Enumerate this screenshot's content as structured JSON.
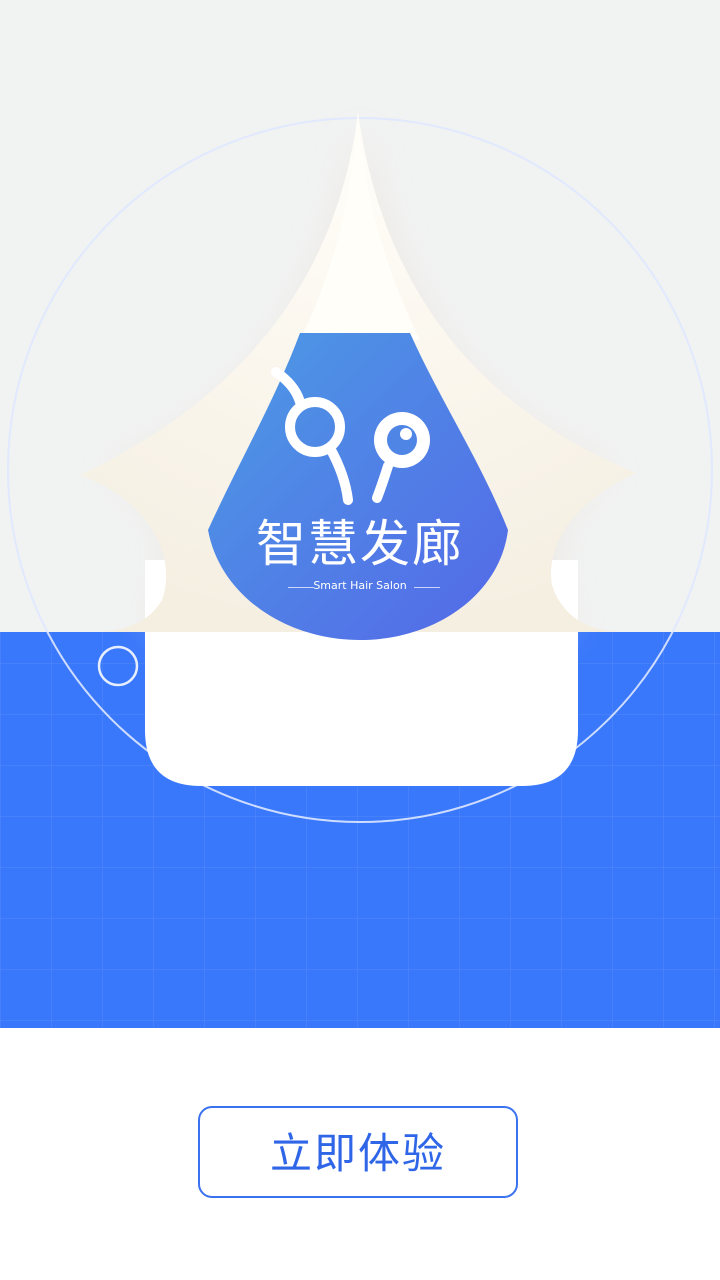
{
  "brand": {
    "title": "智慧发廊",
    "subtitle": "Smart Hair Salon",
    "logo_icon": "scissors-mirror-logo-icon"
  },
  "cta": {
    "label": "立即体验"
  },
  "colors": {
    "top_background": "#f1f2f2",
    "blue_background": "#3a78fb",
    "badge_gradient_start": "#4c9be4",
    "badge_gradient_end": "#5468e8",
    "cta_accent": "#3b72f0",
    "page_background": "#ffffff"
  }
}
